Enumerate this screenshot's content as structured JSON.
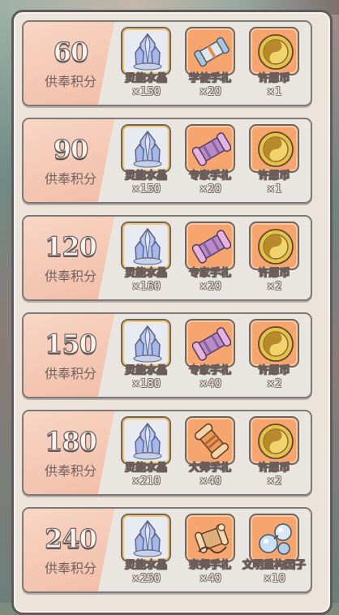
{
  "point_label": "供奉积分",
  "rows": [
    {
      "points": "60",
      "items": [
        {
          "name": "灵能水晶",
          "qty": "×150",
          "icon": "crystal-icon",
          "frame": "blue"
        },
        {
          "name": "学徒手札",
          "qty": "×20",
          "icon": "scroll-icon",
          "frame": "orange"
        },
        {
          "name": "许愿币",
          "qty": "×1",
          "icon": "wish-coin-icon",
          "frame": "orange"
        }
      ]
    },
    {
      "points": "90",
      "items": [
        {
          "name": "灵能水晶",
          "qty": "×150",
          "icon": "crystal-icon",
          "frame": "blue"
        },
        {
          "name": "专家手札",
          "qty": "×20",
          "icon": "expert-scroll-icon",
          "frame": "orange"
        },
        {
          "name": "许愿币",
          "qty": "×1",
          "icon": "wish-coin-icon",
          "frame": "orange"
        }
      ]
    },
    {
      "points": "120",
      "items": [
        {
          "name": "灵能水晶",
          "qty": "×160",
          "icon": "crystal-icon",
          "frame": "blue"
        },
        {
          "name": "专家手札",
          "qty": "×20",
          "icon": "expert-scroll-icon",
          "frame": "orange"
        },
        {
          "name": "许愿币",
          "qty": "×2",
          "icon": "wish-coin-icon",
          "frame": "orange"
        }
      ]
    },
    {
      "points": "150",
      "items": [
        {
          "name": "灵能水晶",
          "qty": "×180",
          "icon": "crystal-icon",
          "frame": "blue"
        },
        {
          "name": "专家手札",
          "qty": "×40",
          "icon": "expert-scroll-icon",
          "frame": "orange"
        },
        {
          "name": "许愿币",
          "qty": "×2",
          "icon": "wish-coin-icon",
          "frame": "orange"
        }
      ]
    },
    {
      "points": "180",
      "items": [
        {
          "name": "灵能水晶",
          "qty": "×210",
          "icon": "crystal-icon",
          "frame": "blue"
        },
        {
          "name": "大师手札",
          "qty": "×40",
          "icon": "master-scroll-icon",
          "frame": "orange"
        },
        {
          "name": "许愿币",
          "qty": "×2",
          "icon": "wish-coin-icon",
          "frame": "orange"
        }
      ]
    },
    {
      "points": "240",
      "items": [
        {
          "name": "灵能水晶",
          "qty": "×250",
          "icon": "crystal-icon",
          "frame": "blue"
        },
        {
          "name": "宗师手札",
          "qty": "×40",
          "icon": "grandmaster-scroll-icon",
          "frame": "orange"
        },
        {
          "name": "文明重构因子",
          "qty": "×10",
          "icon": "civilization-factor-icon",
          "frame": "orange"
        }
      ]
    }
  ]
}
